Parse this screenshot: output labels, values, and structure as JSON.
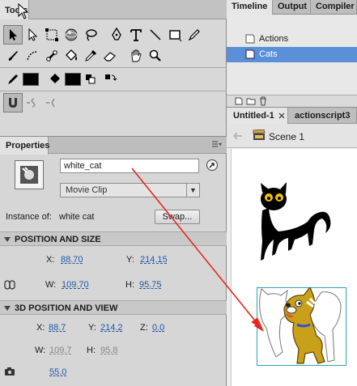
{
  "tools_panel": {
    "title": "Tools"
  },
  "properties_panel": {
    "title": "Properties",
    "instance_name": "white_cat",
    "symbol_type": "Movie Clip",
    "instance_of_label": "Instance of:",
    "instance_of_value": "white cat",
    "swap_button": "Swap...",
    "position_size": {
      "header": "POSITION AND SIZE",
      "x_label": "X:",
      "x": "88.70",
      "y_label": "Y:",
      "y": "214.15",
      "w_label": "W:",
      "w": "109.70",
      "h_label": "H:",
      "h": "95.75"
    },
    "position_3d": {
      "header": "3D POSITION AND VIEW",
      "x_label": "X:",
      "x": "88.7",
      "y_label": "Y:",
      "y": "214.2",
      "z_label": "Z:",
      "z": "0.0",
      "w_label": "W:",
      "w": "109.7",
      "h_label": "H:",
      "h": "95.8",
      "perspective": "55.0"
    }
  },
  "timeline_panel": {
    "tabs": [
      "Timeline",
      "Output",
      "Compiler Errors"
    ],
    "layers": [
      {
        "name": "Actions",
        "selected": false
      },
      {
        "name": "Cats",
        "selected": true
      }
    ]
  },
  "document": {
    "tabs": [
      "Untitled-1",
      "actionscript3"
    ],
    "scene": "Scene 1"
  },
  "colors": {
    "selection": "#5b8fd8",
    "link_value": "#2157a5",
    "arrow": "#e8261f"
  }
}
